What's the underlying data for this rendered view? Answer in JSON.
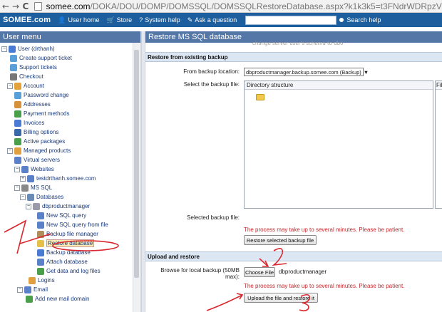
{
  "browser": {
    "back": "←",
    "forward": "→",
    "reload": "C",
    "url_host": "somee.com",
    "url_path": "/DOKA/DOU/DOMP/DOMSSQL/DOMSSQLRestoreDatabase.aspx?k1k3k5=t3FNdrWDRpzVSJp%2fo75zv1fM"
  },
  "site_bar": {
    "logo": "SOMEE.com",
    "links": [
      "User home",
      "Store",
      "System help",
      "Ask a question"
    ],
    "search_label": "Search help"
  },
  "left_panel": {
    "title": "User menu",
    "items": [
      {
        "label": "User (drthanh)",
        "toggle": "⊟"
      },
      {
        "label": "Create support ticket"
      },
      {
        "label": "Support tickets"
      },
      {
        "label": "Checkout"
      },
      {
        "label": "Account",
        "toggle": "⊟"
      },
      {
        "label": "Password change"
      },
      {
        "label": "Addresses"
      },
      {
        "label": "Payment methods"
      },
      {
        "label": "Invoices"
      },
      {
        "label": "Billing options"
      },
      {
        "label": "Active packages"
      },
      {
        "label": "Managed products",
        "toggle": "⊟"
      },
      {
        "label": "Virtual servers"
      },
      {
        "label": "Websites",
        "toggle": "⊟"
      },
      {
        "label": "testdrthanh.somee.com",
        "toggle": "⊞"
      },
      {
        "label": "MS SQL",
        "toggle": "⊟"
      },
      {
        "label": "Databases",
        "toggle": "⊟"
      },
      {
        "label": "dbproductmanager",
        "toggle": "⊟"
      },
      {
        "label": "New SQL query"
      },
      {
        "label": "New SQL query from file"
      },
      {
        "label": "Backup file manager"
      },
      {
        "label": "Restore database"
      },
      {
        "label": "Backup database"
      },
      {
        "label": "Attach database"
      },
      {
        "label": "Get data and log files"
      },
      {
        "label": "Logins"
      },
      {
        "label": "Email",
        "toggle": "⊟"
      },
      {
        "label": "Add new mail domain"
      }
    ]
  },
  "right_panel": {
    "title": "Restore MS SQL database",
    "cut_text": "change server user's schema to dbo",
    "restore_existing": {
      "header": "Restore from existing backup",
      "from_location_label": "From backup location:",
      "from_location_value": "dbproductmanager.backup.somee.com (Backup)",
      "select_file_label": "Select the backup file:",
      "dir_header": "Directory structure",
      "file_col_header": "File",
      "selected_file_label": "Selected backup file:",
      "note": "The process may take up to several minutes. Please be patient.",
      "restore_button": "Restore selected backup file"
    },
    "upload_restore": {
      "header": "Upload and restore",
      "browse_label_1": "Browse for local backup (50MB",
      "browse_label_2": "max):",
      "choose_button": "Choose File",
      "chosen_file": "dbproductmanager",
      "note": "The process may take up to several minutes. Please be patient.",
      "upload_button": "Upload the file and restore it"
    }
  },
  "annotations": {
    "mark_1": "1",
    "mark_2": "2",
    "mark_3": "3",
    "color": "#d9282f"
  }
}
